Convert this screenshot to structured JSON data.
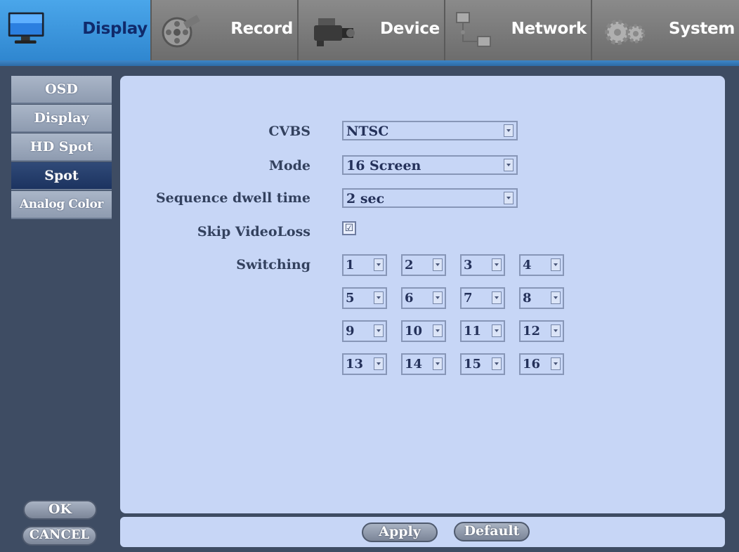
{
  "tabs": [
    {
      "label": "Display",
      "icon": "monitor-icon",
      "active": true
    },
    {
      "label": "Record",
      "icon": "film-reel-icon",
      "active": false
    },
    {
      "label": "Device",
      "icon": "camcorder-icon",
      "active": false
    },
    {
      "label": "Network",
      "icon": "network-icon",
      "active": false
    },
    {
      "label": "System",
      "icon": "gears-icon",
      "active": false
    }
  ],
  "sidebar": {
    "items": [
      {
        "label": "OSD"
      },
      {
        "label": "Display"
      },
      {
        "label": "HD Spot"
      },
      {
        "label": "Spot",
        "active": true
      },
      {
        "label": "Analog Color"
      }
    ],
    "ok_label": "OK",
    "cancel_label": "CANCEL"
  },
  "form": {
    "cvbs": {
      "label": "CVBS",
      "value": "NTSC"
    },
    "mode": {
      "label": "Mode",
      "value": "16 Screen"
    },
    "dwell": {
      "label": "Sequence dwell time",
      "value": "2 sec"
    },
    "skip": {
      "label": "Skip VideoLoss",
      "checked": true,
      "mark": "☑"
    },
    "switching": {
      "label": "Switching",
      "values": [
        "1",
        "2",
        "3",
        "4",
        "5",
        "6",
        "7",
        "8",
        "9",
        "10",
        "11",
        "12",
        "13",
        "14",
        "15",
        "16"
      ]
    }
  },
  "buttons": {
    "apply_label": "Apply",
    "default_label": "Default"
  },
  "colors": {
    "active_tab": "#3a96de",
    "panel": "#c7d6f6",
    "frame": "#3e4c63"
  }
}
